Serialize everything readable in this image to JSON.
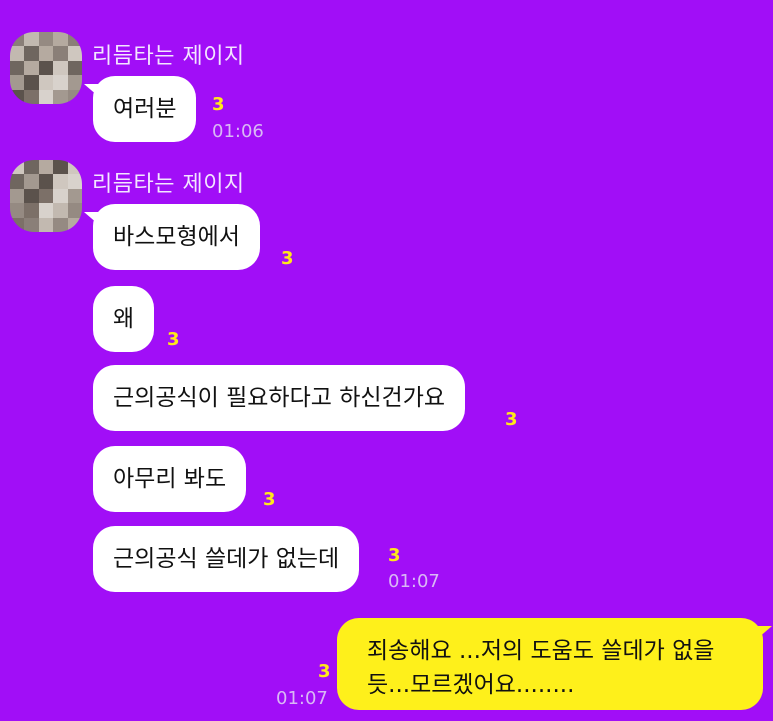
{
  "colors": {
    "background": "#a10ef7",
    "incoming_bubble": "#ffffff",
    "outgoing_bubble": "#fef01b",
    "unread_count": "#ffe81a",
    "timestamp": "#d9b8f5",
    "sender_name": "#f3e6ff"
  },
  "groups": [
    {
      "sender": "리듬타는 제이지",
      "messages": [
        {
          "text": "여러분",
          "unread": "3",
          "time": "01:06"
        }
      ]
    },
    {
      "sender": "리듬타는 제이지",
      "messages": [
        {
          "text": "바스모형에서",
          "unread": "3"
        },
        {
          "text": "왜",
          "unread": "3"
        },
        {
          "text": "근의공식이 필요하다고 하신건가요",
          "unread": "3"
        },
        {
          "text": "아무리 봐도",
          "unread": "3"
        },
        {
          "text": "근의공식 쓸데가 없는데",
          "unread": "3",
          "time": "01:07"
        }
      ]
    }
  ],
  "my_message": {
    "text": "죄송해요 ...저의 도움도 쓸데가 없을 듯...모르겠어요........",
    "unread": "3",
    "time": "01:07"
  }
}
